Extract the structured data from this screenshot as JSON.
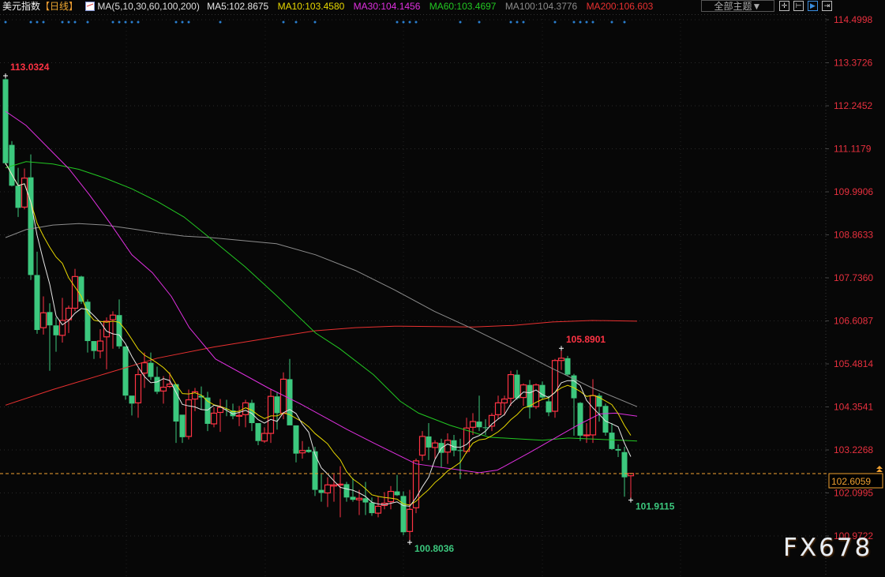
{
  "header": {
    "title": "美元指数",
    "bracket_open": "【",
    "period": "日线",
    "bracket_close": "】",
    "ma_params": "MA(5,10,30,60,100,200)",
    "ma5": "MA5:102.8675",
    "ma10": "MA10:103.4580",
    "ma30": "MA30:104.1456",
    "ma60": "MA60:103.4697",
    "ma100": "MA100:104.3776",
    "ma200": "MA200:106.603",
    "theme_select": "全部主题▼",
    "tool_icons": [
      "crosshair-icon",
      "range-icon",
      "play-icon",
      "exit-icon"
    ]
  },
  "colors": {
    "up": "#ff3344",
    "down": "#3cc87e",
    "ma5": "#e6e6e6",
    "ma10": "#e8d800",
    "ma30": "#e030e0",
    "ma60": "#22c722",
    "ma100": "#8c8c8c",
    "ma200": "#e83030",
    "axis_label": "#e8303e",
    "current": "#f0a030",
    "signal_dot": "#2a7fd0"
  },
  "watermark": "FX678",
  "chart_data": {
    "type": "candlestick",
    "title": "美元指数 日线",
    "ylim": [
      100.9722,
      114.4998
    ],
    "y_ticks": [
      "114.4998",
      "113.3726",
      "112.2452",
      "111.1179",
      "109.9906",
      "108.8633",
      "107.7360",
      "106.6087",
      "105.4814",
      "104.3541",
      "103.2268",
      "102.0995",
      "100.9722"
    ],
    "current_price": "102.6059",
    "ohlc": [
      [
        112.94,
        113.03,
        110.7,
        110.74
      ],
      [
        111.22,
        111.32,
        110.13,
        110.15
      ],
      [
        110.15,
        110.62,
        109.33,
        109.57
      ],
      [
        109.59,
        110.6,
        109.53,
        110.35
      ],
      [
        110.37,
        110.97,
        107.68,
        107.81
      ],
      [
        107.81,
        108.42,
        106.27,
        106.37
      ],
      [
        106.43,
        107.25,
        106.25,
        106.82
      ],
      [
        106.84,
        107.07,
        105.3,
        106.49
      ],
      [
        106.49,
        106.7,
        105.8,
        106.23
      ],
      [
        106.23,
        107.21,
        106.04,
        106.62
      ],
      [
        106.64,
        107.01,
        106.29,
        106.94
      ],
      [
        106.94,
        107.97,
        106.86,
        107.77
      ],
      [
        107.77,
        107.79,
        107.05,
        107.11
      ],
      [
        107.11,
        107.17,
        105.78,
        106.08
      ],
      [
        106.08,
        106.08,
        105.61,
        105.82
      ],
      [
        105.82,
        106.39,
        105.63,
        106.08
      ],
      [
        106.19,
        106.7,
        105.34,
        106.6
      ],
      [
        106.64,
        106.86,
        105.88,
        106.76
      ],
      [
        106.76,
        107.17,
        105.88,
        105.94
      ],
      [
        105.94,
        105.94,
        104.54,
        104.65
      ],
      [
        104.65,
        104.65,
        104.13,
        104.44
      ],
      [
        104.46,
        105.36,
        104.07,
        105.2
      ],
      [
        105.24,
        105.78,
        104.85,
        105.51
      ],
      [
        105.51,
        105.78,
        105.06,
        105.14
      ],
      [
        105.14,
        105.41,
        104.69,
        104.75
      ],
      [
        104.77,
        105.16,
        104.44,
        104.87
      ],
      [
        104.89,
        105.26,
        104.85,
        104.95
      ],
      [
        104.95,
        104.95,
        103.41,
        103.97
      ],
      [
        104.15,
        104.15,
        103.41,
        103.56
      ],
      [
        103.58,
        104.81,
        103.5,
        104.54
      ],
      [
        104.56,
        104.85,
        104.24,
        104.75
      ],
      [
        104.65,
        104.89,
        104.28,
        104.6
      ],
      [
        104.6,
        104.75,
        103.72,
        103.91
      ],
      [
        103.91,
        104.34,
        103.82,
        104.19
      ],
      [
        104.21,
        104.56,
        103.7,
        104.34
      ],
      [
        104.3,
        104.54,
        104.11,
        104.28
      ],
      [
        104.26,
        104.44,
        104.03,
        104.11
      ],
      [
        104.12,
        104.38,
        103.85,
        104.13
      ],
      [
        104.15,
        104.54,
        103.82,
        104.46
      ],
      [
        104.46,
        104.54,
        103.72,
        103.93
      ],
      [
        103.93,
        103.93,
        103.35,
        103.46
      ],
      [
        103.46,
        103.82,
        103.41,
        103.66
      ],
      [
        103.66,
        104.81,
        103.41,
        104.63
      ],
      [
        104.63,
        104.75,
        103.76,
        104.19
      ],
      [
        104.19,
        105.26,
        104.03,
        105.08
      ],
      [
        105.08,
        105.61,
        103.87,
        103.87
      ],
      [
        103.87,
        103.87,
        102.9,
        103.13
      ],
      [
        103.15,
        103.46,
        103.0,
        103.21
      ],
      [
        103.23,
        103.31,
        103.15,
        103.17
      ],
      [
        103.19,
        103.31,
        102.02,
        102.18
      ],
      [
        102.18,
        102.59,
        101.87,
        102.1
      ],
      [
        102.1,
        102.51,
        101.73,
        102.31
      ],
      [
        102.28,
        102.59,
        101.87,
        102.31
      ],
      [
        102.32,
        102.8,
        101.46,
        102.33
      ],
      [
        102.33,
        102.39,
        101.87,
        101.98
      ],
      [
        102.0,
        102.49,
        101.87,
        101.92
      ],
      [
        101.92,
        102.18,
        101.52,
        101.96
      ],
      [
        101.96,
        102.39,
        101.52,
        101.85
      ],
      [
        101.85,
        101.98,
        101.5,
        101.57
      ],
      [
        101.57,
        102.02,
        101.46,
        101.75
      ],
      [
        101.77,
        102.12,
        101.67,
        101.83
      ],
      [
        101.87,
        102.28,
        101.67,
        102.14
      ],
      [
        102.14,
        102.57,
        102.02,
        102.04
      ],
      [
        102.02,
        102.14,
        100.99,
        101.07
      ],
      [
        101.09,
        102.18,
        100.8,
        101.67
      ],
      [
        101.71,
        103.0,
        101.57,
        102.94
      ],
      [
        103.09,
        103.72,
        102.94,
        103.58
      ],
      [
        103.58,
        103.93,
        102.96,
        103.29
      ],
      [
        103.29,
        103.48,
        103.0,
        103.41
      ],
      [
        103.41,
        103.52,
        102.76,
        103.15
      ],
      [
        103.17,
        103.66,
        102.86,
        103.48
      ],
      [
        103.48,
        103.62,
        103.06,
        103.21
      ],
      [
        103.22,
        103.52,
        102.47,
        103.21
      ],
      [
        103.19,
        104.07,
        103.13,
        103.8
      ],
      [
        103.82,
        104.19,
        103.62,
        103.97
      ],
      [
        103.97,
        104.65,
        103.72,
        103.82
      ],
      [
        103.82,
        104.03,
        103.62,
        103.8
      ],
      [
        103.85,
        104.19,
        103.72,
        104.13
      ],
      [
        104.15,
        104.65,
        104.03,
        104.46
      ],
      [
        104.46,
        104.65,
        104.13,
        104.56
      ],
      [
        104.58,
        105.3,
        104.38,
        105.2
      ],
      [
        105.2,
        105.32,
        104.54,
        104.58
      ],
      [
        104.6,
        104.97,
        104.38,
        104.93
      ],
      [
        104.93,
        105.06,
        104.05,
        104.34
      ],
      [
        104.36,
        104.97,
        104.3,
        104.93
      ],
      [
        104.93,
        105.02,
        104.54,
        104.6
      ],
      [
        104.5,
        104.65,
        104.11,
        104.21
      ],
      [
        104.24,
        105.61,
        104.07,
        105.57
      ],
      [
        105.57,
        105.89,
        105.32,
        105.63
      ],
      [
        105.63,
        105.69,
        105.16,
        105.2
      ],
      [
        105.18,
        105.22,
        103.6,
        104.58
      ],
      [
        104.46,
        104.48,
        103.46,
        103.6
      ],
      [
        103.6,
        103.93,
        103.41,
        103.62
      ],
      [
        103.62,
        105.08,
        103.41,
        104.65
      ],
      [
        104.65,
        104.71,
        103.97,
        104.36
      ],
      [
        104.38,
        104.44,
        103.6,
        103.68
      ],
      [
        103.68,
        103.93,
        103.23,
        103.25
      ],
      [
        103.25,
        103.37,
        103.04,
        103.21
      ],
      [
        103.17,
        103.31,
        102.0,
        102.51
      ],
      [
        102.55,
        102.61,
        101.91,
        102.61
      ]
    ],
    "ma_series": {
      "ma30": [
        [
          1,
          112.1
        ],
        [
          4.25,
          111.73
        ],
        [
          7.6,
          111.17
        ],
        [
          11,
          110.6
        ],
        [
          14.25,
          109.92
        ],
        [
          17.6,
          109.16
        ],
        [
          21,
          108.34
        ],
        [
          24.25,
          107.87
        ],
        [
          27.25,
          107.25
        ],
        [
          30.1,
          106.43
        ],
        [
          34.25,
          105.61
        ],
        [
          42.6,
          104.85
        ],
        [
          47.6,
          104.44
        ],
        [
          55.1,
          103.76
        ],
        [
          59.25,
          103.41
        ],
        [
          66,
          102.86
        ],
        [
          76,
          102.63
        ],
        [
          78.9,
          102.7
        ],
        [
          83.9,
          103.15
        ],
        [
          87.6,
          103.5
        ],
        [
          91.75,
          103.89
        ],
        [
          95.1,
          104.17
        ],
        [
          97.6,
          104.19
        ],
        [
          101,
          104.11
        ]
      ],
      "ma60": [
        [
          1,
          110.62
        ],
        [
          4.25,
          110.78
        ],
        [
          8.5,
          110.72
        ],
        [
          12.6,
          110.58
        ],
        [
          16.75,
          110.35
        ],
        [
          21,
          110.07
        ],
        [
          25,
          109.74
        ],
        [
          29.25,
          109.33
        ],
        [
          33.9,
          108.71
        ],
        [
          38.9,
          108.03
        ],
        [
          43.9,
          107.27
        ],
        [
          50.1,
          106.29
        ],
        [
          53.9,
          105.88
        ],
        [
          59.25,
          105.2
        ],
        [
          63.5,
          104.5
        ],
        [
          66.4,
          104.19
        ],
        [
          71.4,
          103.87
        ],
        [
          77.6,
          103.56
        ],
        [
          86,
          103.48
        ],
        [
          90.1,
          103.54
        ],
        [
          98.5,
          103.48
        ],
        [
          101,
          103.46
        ]
      ],
      "ma100": [
        [
          1,
          108.79
        ],
        [
          4.25,
          109.0
        ],
        [
          8.5,
          109.12
        ],
        [
          12.6,
          109.16
        ],
        [
          16.75,
          109.12
        ],
        [
          21,
          109.02
        ],
        [
          25,
          108.92
        ],
        [
          29.25,
          108.83
        ],
        [
          33.5,
          108.79
        ],
        [
          43.9,
          108.63
        ],
        [
          50.1,
          108.34
        ],
        [
          56.4,
          107.93
        ],
        [
          62.6,
          107.42
        ],
        [
          68.9,
          106.86
        ],
        [
          75.1,
          106.39
        ],
        [
          81.4,
          105.88
        ],
        [
          87.6,
          105.36
        ],
        [
          93.9,
          104.85
        ],
        [
          101,
          104.36
        ]
      ],
      "ma200": [
        [
          1,
          104.4
        ],
        [
          8.5,
          104.81
        ],
        [
          16.75,
          105.22
        ],
        [
          25,
          105.63
        ],
        [
          33.9,
          105.92
        ],
        [
          43.9,
          106.19
        ],
        [
          50.1,
          106.35
        ],
        [
          56.4,
          106.43
        ],
        [
          62.6,
          106.47
        ],
        [
          75.1,
          106.45
        ],
        [
          81.4,
          106.49
        ],
        [
          87.6,
          106.58
        ],
        [
          93.9,
          106.62
        ],
        [
          101,
          106.6
        ]
      ]
    },
    "annotations": [
      {
        "text": "113.0324",
        "candle": 1,
        "value": 113.0324,
        "kind": "high"
      },
      {
        "text": "105.8901",
        "candle": 89,
        "value": 105.8901,
        "kind": "high"
      },
      {
        "text": "100.8036",
        "candle": 65,
        "value": 100.8036,
        "kind": "low"
      },
      {
        "text": "101.9115",
        "candle": 100,
        "value": 101.9115,
        "kind": "low"
      }
    ],
    "signal_dots": [
      1,
      5,
      6,
      7,
      10,
      11,
      12,
      14,
      18,
      19,
      20,
      21,
      22,
      28,
      29,
      30,
      35,
      45,
      47,
      50,
      63,
      64,
      65,
      66,
      73,
      76,
      81,
      82,
      83,
      88,
      91,
      92,
      93,
      94,
      97,
      99
    ],
    "grid": true
  }
}
